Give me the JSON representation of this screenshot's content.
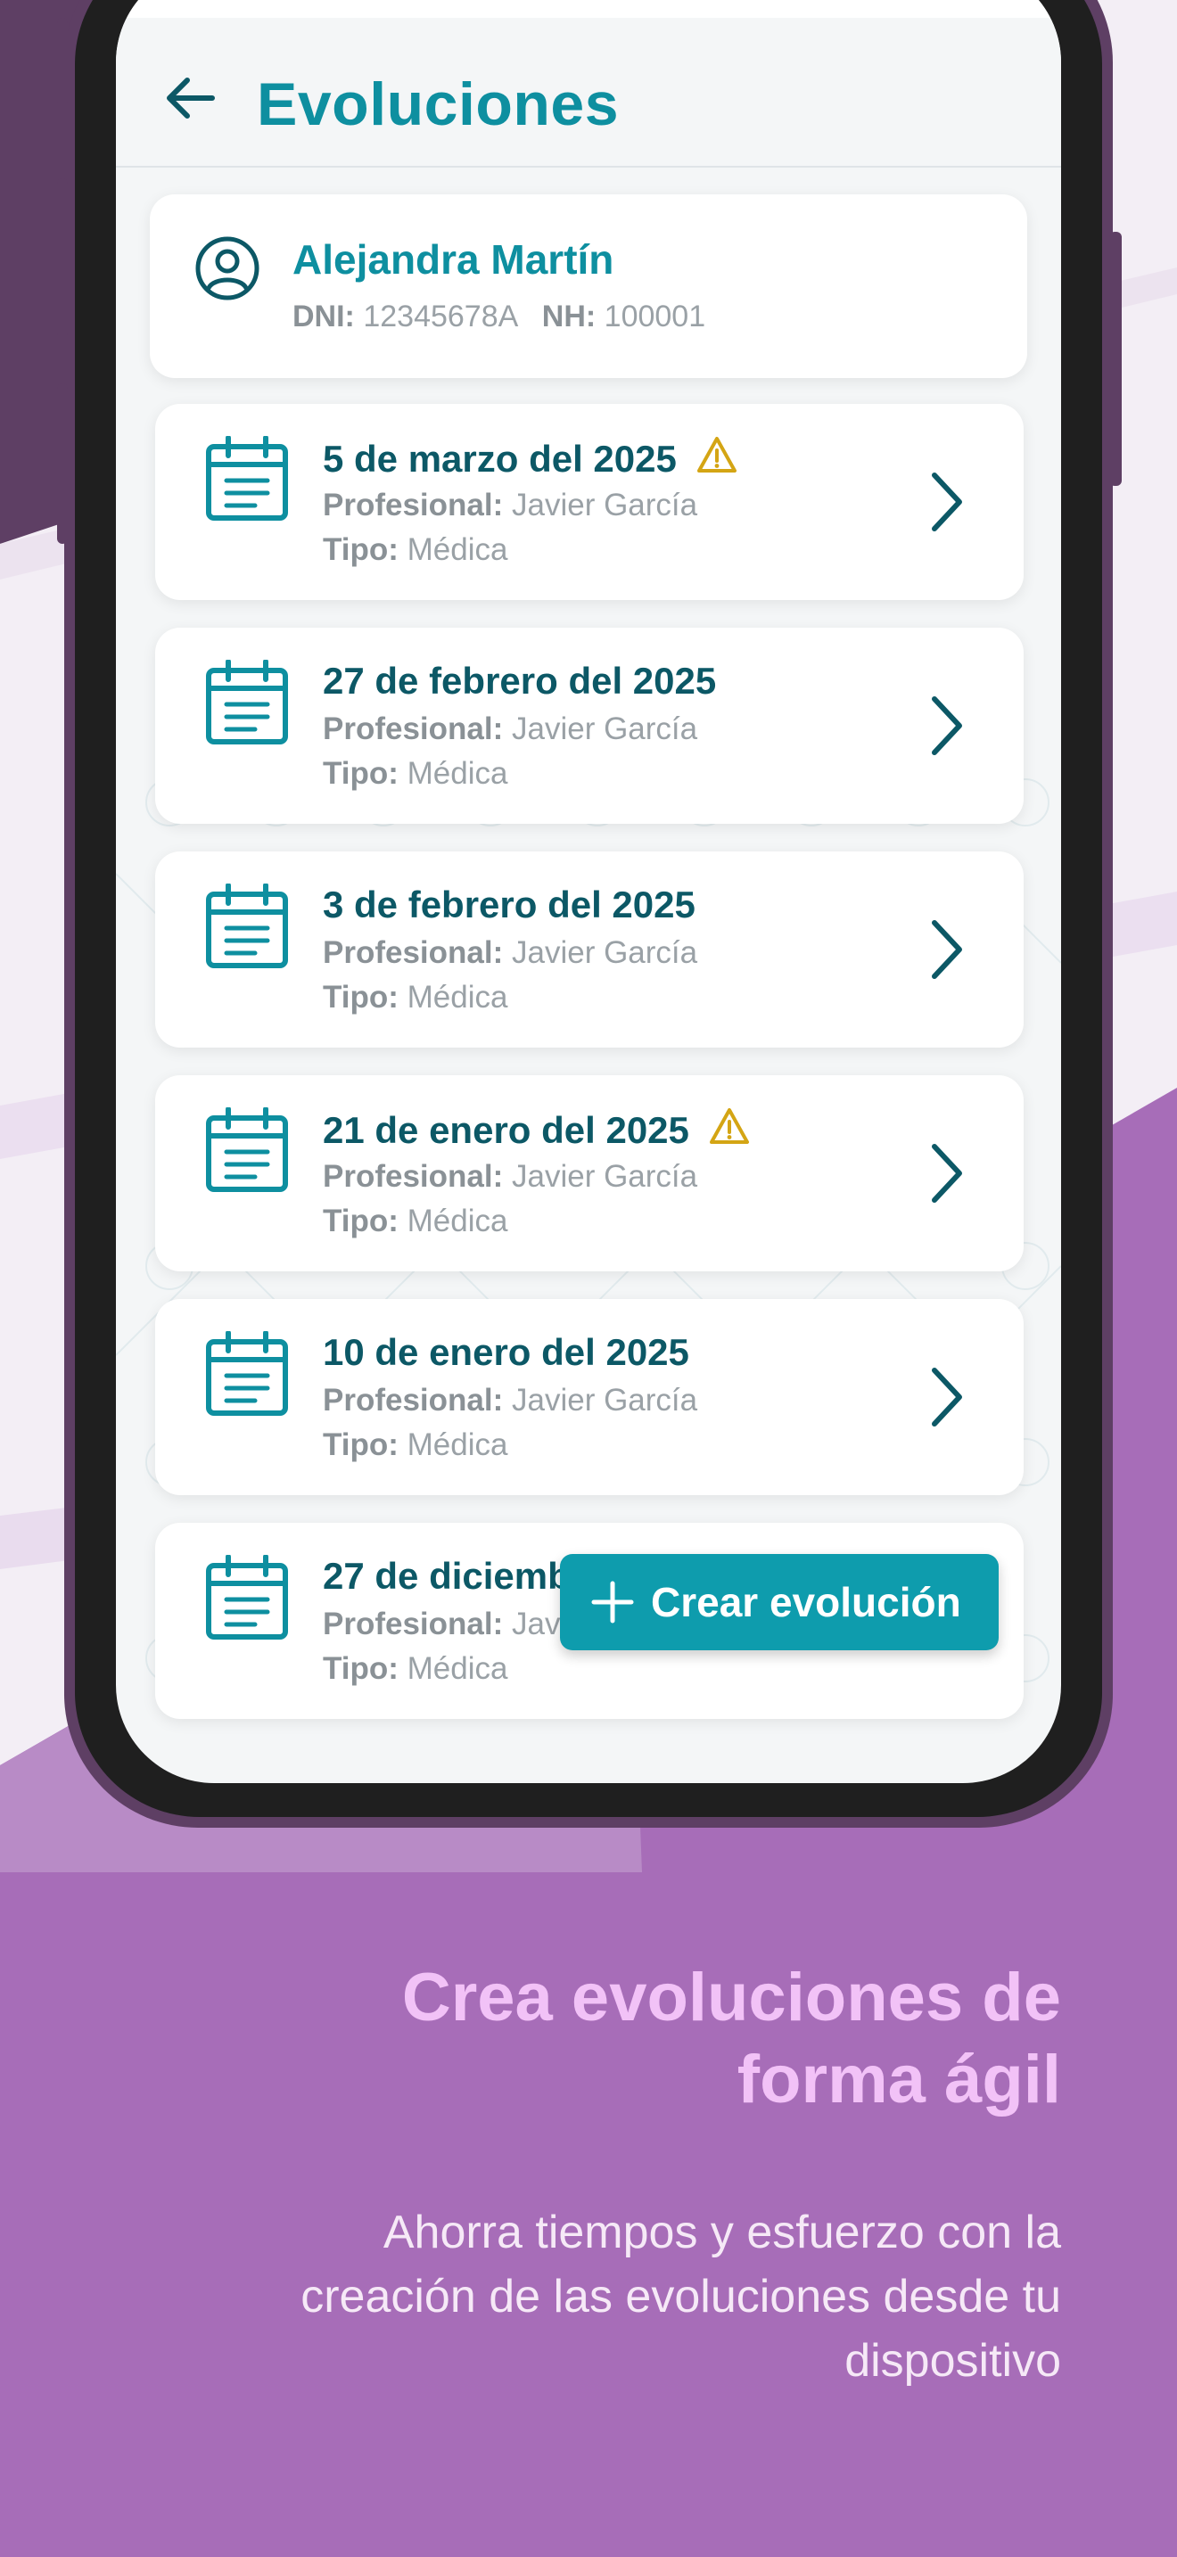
{
  "colors": {
    "accent": "#0e8fa0",
    "dark_teal": "#0c5866",
    "fab": "#0e9cad",
    "warning": "#d4a514",
    "purple_bg": "#a76db8",
    "headline": "#f2c2f7"
  },
  "header": {
    "back_icon": "arrow-left-icon",
    "title": "Evoluciones"
  },
  "patient": {
    "icon": "user-circle-icon",
    "name": "Alejandra Martín",
    "dni_label": "DNI:",
    "dni": "12345678A",
    "nh_label": "NH:",
    "nh": "100001"
  },
  "evolutions": [
    {
      "date": "5 de marzo del 2025",
      "warning": true,
      "prof_label": "Profesional:",
      "professional": "Javier García",
      "type_label": "Tipo:",
      "type": "Médica"
    },
    {
      "date": "27 de febrero del 2025",
      "warning": false,
      "prof_label": "Profesional:",
      "professional": "Javier García",
      "type_label": "Tipo:",
      "type": "Médica"
    },
    {
      "date": "3 de febrero del 2025",
      "warning": false,
      "prof_label": "Profesional:",
      "professional": "Javier García",
      "type_label": "Tipo:",
      "type": "Médica"
    },
    {
      "date": "21 de enero del 2025",
      "warning": true,
      "prof_label": "Profesional:",
      "professional": "Javier García",
      "type_label": "Tipo:",
      "type": "Médica"
    },
    {
      "date": "10 de enero del 2025",
      "warning": false,
      "prof_label": "Profesional:",
      "professional": "Javier García",
      "type_label": "Tipo:",
      "type": "Médica"
    },
    {
      "date": "27 de diciembre del 2024",
      "warning": false,
      "prof_label": "Profesional:",
      "professional": "Javier García",
      "type_label": "Tipo:",
      "type": "Médica"
    }
  ],
  "fab": {
    "icon": "plus-icon",
    "label": "Crear evolución"
  },
  "promo": {
    "headline_line1": "Crea evoluciones de",
    "headline_line2": "forma ágil",
    "subtext_line1": "Ahorra tiempos y esfuerzo con la",
    "subtext_line2": "creación de las evoluciones desde tu",
    "subtext_line3": "dispositivo"
  }
}
